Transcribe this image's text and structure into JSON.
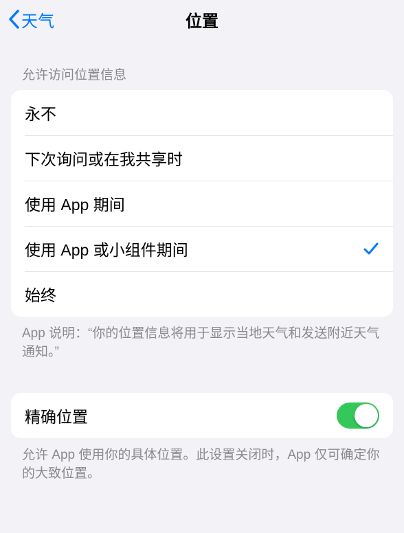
{
  "nav": {
    "back_label": "天气",
    "title": "位置"
  },
  "section1": {
    "header": "允许访问位置信息",
    "options": [
      {
        "label": "永不",
        "selected": false
      },
      {
        "label": "下次询问或在我共享时",
        "selected": false
      },
      {
        "label": "使用 App 期间",
        "selected": false
      },
      {
        "label": "使用 App 或小组件期间",
        "selected": true
      },
      {
        "label": "始终",
        "selected": false
      }
    ],
    "footer": "App 说明：“你的位置信息将用于显示当地天气和发送附近天气通知。”"
  },
  "section2": {
    "precise_location_label": "精确位置",
    "precise_location_on": true,
    "footer": "允许 App 使用你的具体位置。此设置关闭时，App 仅可确定你的大致位置。"
  }
}
